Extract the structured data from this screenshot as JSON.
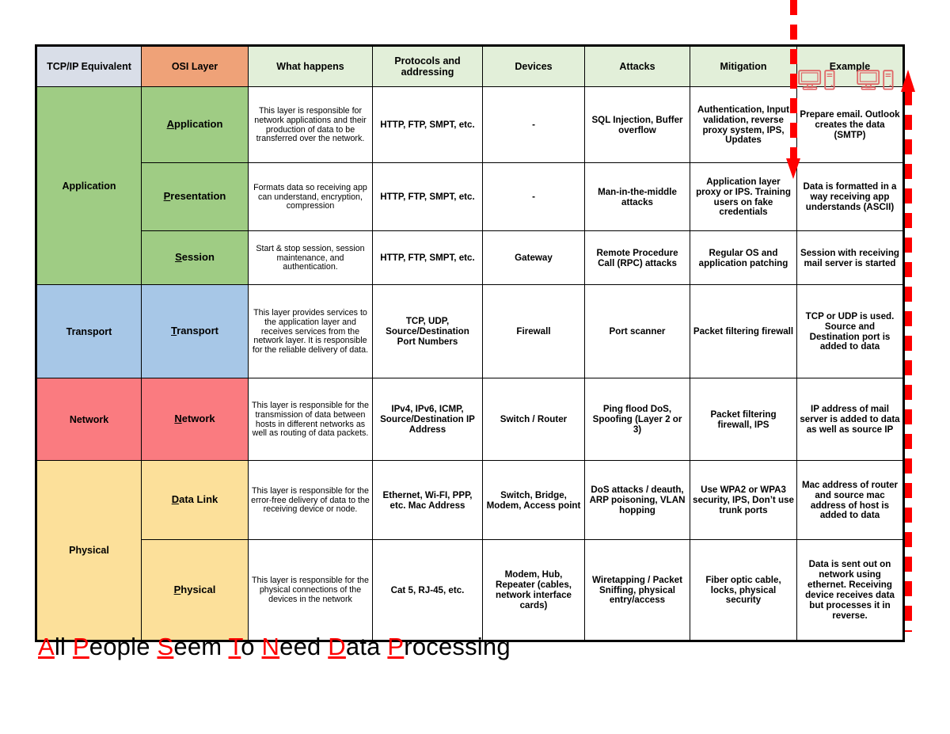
{
  "table": {
    "headers": [
      {
        "key": "tcpip",
        "label": "TCP/IP Equivalent",
        "bg": "#D9DEE8"
      },
      {
        "key": "osi",
        "label": "OSI Layer",
        "bg": "#EFA278"
      },
      {
        "key": "what",
        "label": "What happens",
        "bg": "#E2EFD9"
      },
      {
        "key": "protocols",
        "label": "Protocols and addressing",
        "bg": "#E2EFD9"
      },
      {
        "key": "devices",
        "label": "Devices",
        "bg": "#E2EFD9"
      },
      {
        "key": "attacks",
        "label": "Attacks",
        "bg": "#E2EFD9"
      },
      {
        "key": "mitigation",
        "label": "Mitigation",
        "bg": "#E2EFD9"
      },
      {
        "key": "example",
        "label": "Example",
        "bg": "#E2EFD9"
      }
    ],
    "tcpip_groups": [
      {
        "label": "Application",
        "rowspan": 3,
        "color": "#9FCC84"
      },
      {
        "label": "Transport",
        "rowspan": 1,
        "color": "#A7C7E7"
      },
      {
        "label": "Network",
        "rowspan": 1,
        "color": "#FA7B80"
      },
      {
        "label": "Physical",
        "rowspan": 2,
        "color": "#FCE09A"
      }
    ],
    "rows": [
      {
        "osi_layer": "Application",
        "osi_initial": "A",
        "osi_rest": "pplication",
        "color": "#9FCC84",
        "what": "This layer is responsible for network applications and their production of data to be transferred over the network.",
        "protocols": "HTTP, FTP, SMPT, etc.",
        "devices": "-",
        "attacks": "SQL Injection, Buffer overflow",
        "mitigation": "Authentication, Input validation, reverse proxy system, IPS, Updates",
        "example": "Prepare email. Outlook creates the data (SMTP)"
      },
      {
        "osi_layer": "Presentation",
        "osi_initial": "P",
        "osi_rest": "resentation",
        "color": "#9FCC84",
        "what": "Formats data so receiving app can understand, encryption, compression",
        "protocols": "HTTP, FTP, SMPT, etc.",
        "devices": "-",
        "attacks": "Man-in-the-middle attacks",
        "mitigation": "Application layer proxy or IPS. Training users on fake credentials",
        "example": "Data is formatted in a way receiving app understands (ASCII)"
      },
      {
        "osi_layer": "Session",
        "osi_initial": "S",
        "osi_rest": "ession",
        "color": "#9FCC84",
        "what": "Start & stop session, session maintenance, and authentication.",
        "protocols": "HTTP, FTP, SMPT, etc.",
        "devices": "Gateway",
        "attacks": "Remote Procedure Call (RPC) attacks",
        "mitigation": "Regular OS and application patching",
        "example": "Session with receiving mail server is started"
      },
      {
        "osi_layer": "Transport",
        "osi_initial": "T",
        "osi_rest": "ransport",
        "color": "#A7C7E7",
        "what": "This layer provides services to the application layer and receives services from the network layer. It is responsible for the reliable delivery of data.",
        "protocols": "TCP, UDP, Source/Destination Port Numbers",
        "devices": "Firewall",
        "attacks": "Port scanner",
        "mitigation": "Packet filtering firewall",
        "example": "TCP or UDP is used. Source and Destination port is added to data"
      },
      {
        "osi_layer": "Network",
        "osi_initial": "N",
        "osi_rest": "etwork",
        "color": "#FA7B80",
        "what": "This layer is responsible for the transmission of data between hosts in different networks as well as routing of data packets.",
        "protocols": "IPv4, IPv6, ICMP, Source/Destination IP Address",
        "devices": "Switch / Router",
        "attacks": "Ping flood DoS, Spoofing (Layer 2 or 3)",
        "mitigation": "Packet filtering firewall, IPS",
        "example": "IP address of mail server is added to data as well as source IP"
      },
      {
        "osi_layer": "Data Link",
        "osi_initial": "D",
        "osi_rest": "ata Link",
        "color": "#FCE09A",
        "what": "This layer is responsible for the error-free delivery of data to the receiving device or node.",
        "protocols": "Ethernet, Wi-FI, PPP, etc. Mac Address",
        "devices": "Switch, Bridge, Modem, Access point",
        "attacks": "DoS attacks / deauth, ARP poisoning, VLAN hopping",
        "mitigation": "Use WPA2 or WPA3 security, IPS, Don’t use trunk ports",
        "example": "Mac address of router and source mac address of host is added to data"
      },
      {
        "osi_layer": "Physical",
        "osi_initial": "P",
        "osi_rest": "hysical",
        "color": "#FCE09A",
        "what": "This layer is responsible for the physical connections of the devices in the network",
        "protocols": "Cat 5, RJ-45, etc.",
        "devices": "Modem, Hub, Repeater (cables, network interface cards)",
        "attacks": "Wiretapping / Packet Sniffing, physical entry/access",
        "mitigation": "Fiber optic cable, locks, physical security",
        "example": "Data is sent out on network using ethernet. Receiving device receives data but processes it in reverse."
      }
    ]
  },
  "mnemonic": {
    "words": [
      {
        "cap": "A",
        "rest": "ll"
      },
      {
        "cap": "P",
        "rest": "eople"
      },
      {
        "cap": "S",
        "rest": "eem"
      },
      {
        "cap": "T",
        "rest": "o"
      },
      {
        "cap": "N",
        "rest": "eed"
      },
      {
        "cap": "D",
        "rest": "ata"
      },
      {
        "cap": "P",
        "rest": "rocessing"
      }
    ],
    "full_text": "All People Seem To Need Data Processing",
    "accent_color": "#FF0000"
  },
  "annotations": {
    "encapsulation_arrow_direction": "down",
    "decapsulation_arrow_direction": "up",
    "arrow_color": "#FF0000",
    "icons": [
      "monitor-icon",
      "computer-tower-icon",
      "monitor-icon",
      "computer-tower-icon"
    ]
  }
}
